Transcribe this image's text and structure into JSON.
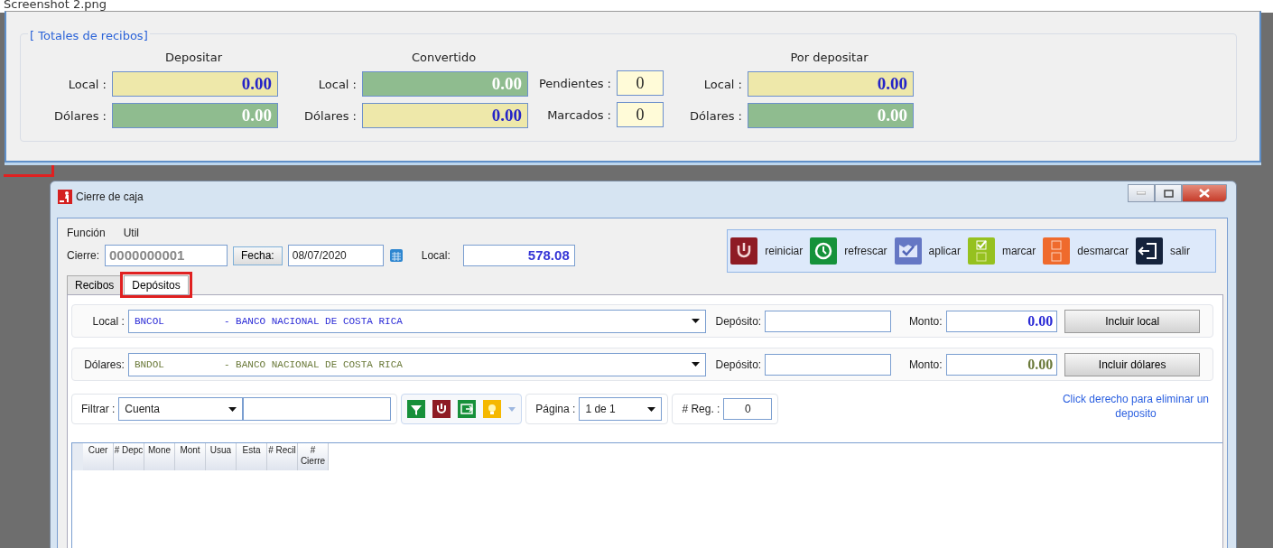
{
  "file_caption": "Screenshot 2.png",
  "totals_window": {
    "group_title": "[ Totales de recibos]",
    "columns": [
      {
        "kind": "amounts",
        "heading": "Depositar",
        "fields": [
          {
            "label": "Local :",
            "value": "0.00",
            "color": "#eee8aa"
          },
          {
            "label": "Dólares :",
            "value": "0.00",
            "color": "#8fbc8f"
          }
        ]
      },
      {
        "kind": "amounts",
        "heading": "Convertido",
        "fields": [
          {
            "label": "Local :",
            "value": "0.00",
            "color": "#8fbc8f"
          },
          {
            "label": "Dólares :",
            "value": "0.00",
            "color": "#eee8aa"
          }
        ]
      },
      {
        "kind": "counters",
        "fields": [
          {
            "label": "Pendientes :",
            "value": "0"
          },
          {
            "label": "Marcados :",
            "value": "0"
          }
        ]
      },
      {
        "kind": "amounts",
        "heading": "Por depositar",
        "fields": [
          {
            "label": "Local :",
            "value": "0.00",
            "color": "#eee8aa"
          },
          {
            "label": "Dólares :",
            "value": "0.00",
            "color": "#8fbc8f"
          }
        ]
      }
    ]
  },
  "main_window": {
    "title": "Cierre de caja",
    "menu": [
      "Función",
      "Util"
    ],
    "cierre": {
      "label": "Cierre:",
      "value": "0000000001"
    },
    "fecha": {
      "button": "Fecha:",
      "value": "08/07/2020"
    },
    "local": {
      "label": "Local:",
      "value": "578.08"
    },
    "toolbar": [
      {
        "kind": "power",
        "label": "reiniciar"
      },
      {
        "kind": "refresh",
        "label": "refrescar"
      },
      {
        "kind": "apply",
        "label": "aplicar"
      },
      {
        "kind": "mark",
        "label": "marcar"
      },
      {
        "kind": "unmark",
        "label": "desmarcar"
      },
      {
        "kind": "exit",
        "label": "salir"
      }
    ],
    "tabs": [
      {
        "label": "Recibos",
        "selected": false,
        "highlighted": false
      },
      {
        "label": "Depósitos",
        "selected": true,
        "highlighted": true
      }
    ],
    "bank_rows": [
      {
        "label": "Local :",
        "bank": "BNCOL          - BANCO NACIONAL DE COSTA RICA",
        "deposit_label": "Depósito:",
        "amount_label": "Monto:",
        "amount": "0.00",
        "button": "Incluir local",
        "color": "#2b2bd6"
      },
      {
        "label": "Dólares:",
        "bank": "BNDOL          - BANCO NACIONAL DE COSTA RICA",
        "deposit_label": "Depósito:",
        "amount_label": "Monto:",
        "amount": "0.00",
        "button": "Incluir dólares",
        "color": "#6b7a3a"
      }
    ],
    "filter": {
      "label": "Filtrar :",
      "field": "Cuenta",
      "tools": [
        {
          "kind": "filter"
        },
        {
          "kind": "power"
        },
        {
          "kind": "export"
        },
        {
          "kind": "bulb"
        }
      ],
      "page_label": "Página :",
      "page": "1 de 1",
      "reg_label": "# Reg. :",
      "reg": "0"
    },
    "hint": "Click derecho para eliminar un deposito",
    "grid_columns": [
      "Cuer",
      "# Depc",
      "Mone",
      "Mont",
      "Usua",
      "Esta",
      "# Recil",
      "# Cierre"
    ]
  }
}
